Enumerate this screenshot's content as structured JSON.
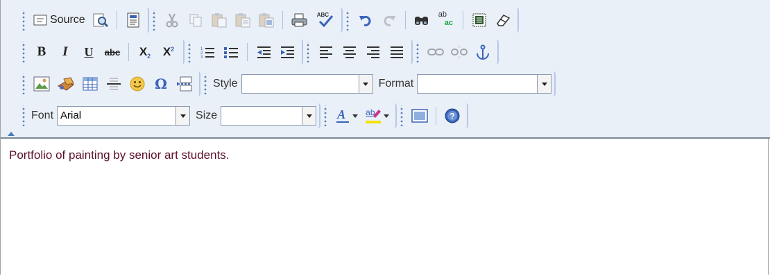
{
  "toolbar": {
    "source_label": "Source",
    "style_label": "Style",
    "style_value": "",
    "format_label": "Format",
    "format_value": "",
    "font_label": "Font",
    "font_value": "Arial",
    "size_label": "Size",
    "size_value": "",
    "icons": {
      "row1": [
        "source-icon",
        "preview-icon",
        "templates-icon",
        "cut-icon",
        "copy-icon",
        "paste-icon",
        "paste-text-icon",
        "paste-word-icon",
        "print-icon",
        "spellcheck-icon",
        "undo-icon",
        "redo-icon",
        "find-icon",
        "replace-icon",
        "select-all-icon",
        "remove-format-icon"
      ],
      "row2": [
        "bold-icon",
        "italic-icon",
        "underline-icon",
        "strikethrough-icon",
        "subscript-icon",
        "superscript-icon",
        "numbered-list-icon",
        "bulleted-list-icon",
        "outdent-icon",
        "indent-icon",
        "align-left-icon",
        "align-center-icon",
        "align-right-icon",
        "justify-icon",
        "link-icon",
        "unlink-icon",
        "anchor-icon"
      ],
      "row3": [
        "image-icon",
        "flash-icon",
        "table-icon",
        "horizontal-rule-icon",
        "smiley-icon",
        "special-char-icon",
        "page-break-icon"
      ],
      "row4": [
        "text-color-icon",
        "background-color-icon",
        "show-blocks-icon",
        "about-icon"
      ]
    },
    "glyphs": {
      "bold": "B",
      "italic": "I",
      "underline": "U",
      "strike": "abc",
      "sub_x": "X",
      "sub_2": "2",
      "sup_x": "X",
      "sup_2": "2",
      "omega": "Ω",
      "replace_ab": "ab",
      "replace_ac": "ac",
      "spell_abc": "ABC",
      "text_color_a": "A",
      "bg_color_ab": "ab"
    }
  },
  "colors": {
    "toolbar_bg": "#eaf0f8",
    "accent": "#3a63b8",
    "content_text": "#5a0f2a"
  },
  "content": {
    "text": "Portfolio of painting by senior art  students."
  }
}
